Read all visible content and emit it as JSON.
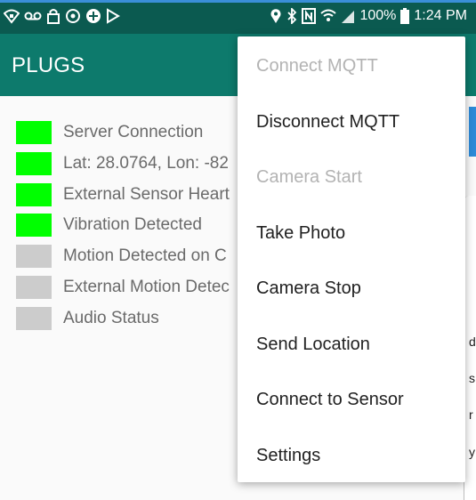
{
  "status_bar": {
    "left_icons": [
      "wifi-lock-icon",
      "voicemail-icon",
      "lock-icon",
      "sync-icon",
      "plus-icon",
      "play-store-icon"
    ],
    "right_icons": [
      "location-icon",
      "bluetooth-icon",
      "nfc-icon",
      "wifi-icon",
      "signal-icon",
      "battery-icon"
    ],
    "battery": "100%",
    "time": "1:24 PM",
    "colors": {
      "background": "#0b5a50",
      "text": "#ffffff"
    }
  },
  "app_bar": {
    "title": "PLUGS",
    "colors": {
      "background": "#0d7a6c"
    }
  },
  "status_items": [
    {
      "label": "Server Connection",
      "state": "on"
    },
    {
      "label": "Lat: 28.0764, Lon: -82",
      "state": "on"
    },
    {
      "label": "External Sensor Heart",
      "state": "on"
    },
    {
      "label": "Vibration Detected",
      "state": "on"
    },
    {
      "label": "Motion Detected on C",
      "state": "off"
    },
    {
      "label": "External Motion Detec",
      "state": "off"
    },
    {
      "label": "Audio Status",
      "state": "off"
    }
  ],
  "indicator_colors": {
    "on": "#00ff00",
    "off": "#cccccc"
  },
  "peek_chars": [
    "d",
    "s",
    "r",
    "y"
  ],
  "menu": {
    "items": [
      {
        "label": "Connect MQTT",
        "enabled": false
      },
      {
        "label": "Disconnect MQTT",
        "enabled": true
      },
      {
        "label": "Camera Start",
        "enabled": false
      },
      {
        "label": "Take Photo",
        "enabled": true
      },
      {
        "label": "Camera Stop",
        "enabled": true
      },
      {
        "label": "Send Location",
        "enabled": true
      },
      {
        "label": "Connect to Sensor",
        "enabled": true
      },
      {
        "label": "Settings",
        "enabled": true
      }
    ]
  }
}
